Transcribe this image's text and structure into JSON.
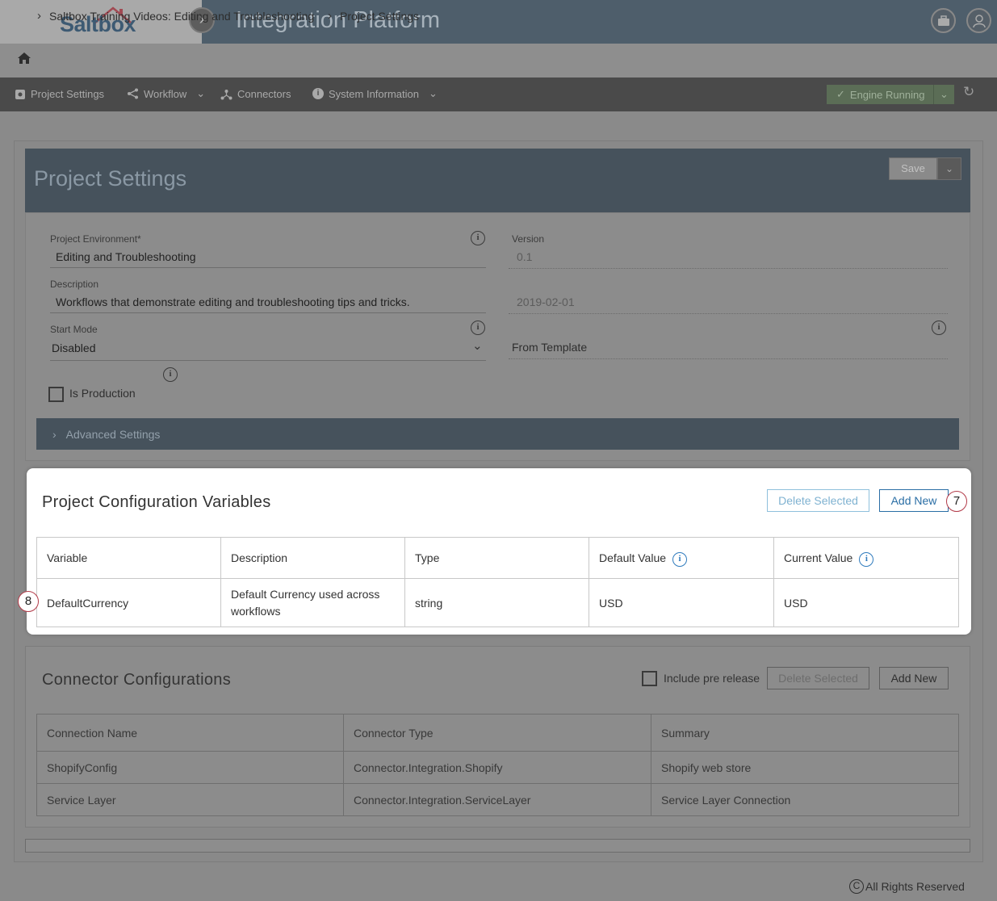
{
  "header": {
    "logo_text": "Saltbox",
    "app_title": "Integration Platform"
  },
  "breadcrumb": {
    "items": [
      "Saltbox Training Videos: Editing and Troubleshooting",
      "Project Settings"
    ]
  },
  "toolbar": {
    "project_settings": "Project Settings",
    "workflow": "Workflow",
    "connectors": "Connectors",
    "system_information": "System Information",
    "engine_status": "Engine Running"
  },
  "project_settings": {
    "title": "Project Settings",
    "save_label": "Save",
    "environment_label": "Project Environment*",
    "environment_value": "Editing and Troubleshooting",
    "version_label": "Version",
    "version_value": "0.1",
    "description_label": "Description",
    "description_value": "Workflows that demonstrate editing and troubleshooting tips and tricks.",
    "date_value": "2019-02-01",
    "start_mode_label": "Start Mode",
    "start_mode_value": "Disabled",
    "template_value": "From Template",
    "is_production_label": "Is Production",
    "advanced_settings_label": "Advanced Settings"
  },
  "config_variables": {
    "title": "Project Configuration Variables",
    "delete_selected_label": "Delete Selected",
    "add_new_label": "Add New",
    "columns": [
      "Variable",
      "Description",
      "Type",
      "Default Value",
      "Current Value"
    ],
    "rows": [
      {
        "variable": "DefaultCurrency",
        "description": "Default Currency used across workflows",
        "type": "string",
        "default_value": "USD",
        "current_value": "USD"
      }
    ],
    "callouts": [
      "7",
      "8"
    ]
  },
  "connector_configs": {
    "title": "Connector Configurations",
    "include_pre_release_label": "Include pre release",
    "delete_selected_label": "Delete Selected",
    "add_new_label": "Add New",
    "columns": [
      "Connection Name",
      "Connector Type",
      "Summary"
    ],
    "rows": [
      {
        "name": "ShopifyConfig",
        "type": "Connector.Integration.Shopify",
        "summary": "Shopify web store"
      },
      {
        "name": "Service Layer",
        "type": "Connector.Integration.ServiceLayer",
        "summary": "Service Layer Connection"
      }
    ]
  },
  "footer": {
    "copyright_symbol": "C",
    "text": "All Rights Reserved"
  },
  "colors": {
    "header_bg": "#4e5e6b",
    "highlight_card": "#ffffff",
    "accent_blue": "#2f7bbd",
    "callout_border": "#b23a48"
  }
}
